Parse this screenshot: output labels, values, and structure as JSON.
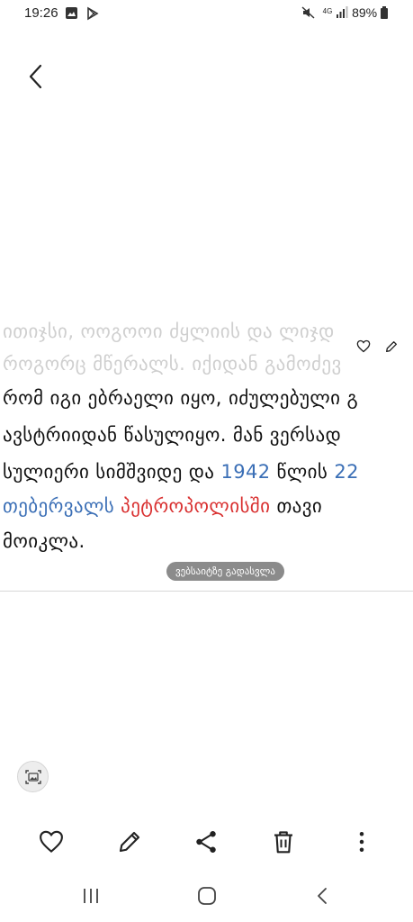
{
  "status_bar": {
    "time": "19:26",
    "network": "4G",
    "battery": "89%"
  },
  "article": {
    "lines": [
      [
        {
          "text": "ითიჯსი, ოოგოოი ძყლიის და ლიჯდ",
          "style": "faded"
        }
      ],
      [
        {
          "text": "როგორც მწერალს. იქიდან გამოძევ",
          "style": "faded"
        }
      ],
      [
        {
          "text": "რომ იგი ებრაელი იყო, იძულებული გ",
          "style": ""
        }
      ],
      [
        {
          "text": "ავსტრიიდან წასულიყო. მან ვერსად",
          "style": ""
        }
      ],
      [
        {
          "text": "სულიერი სიმშვიდე და ",
          "style": ""
        },
        {
          "text": "1942",
          "style": "blue"
        },
        {
          "text": " წლის ",
          "style": ""
        },
        {
          "text": "22",
          "style": "blue"
        }
      ],
      [
        {
          "text": "თებერვალს",
          "style": "blue"
        },
        {
          "text": " ",
          "style": ""
        },
        {
          "text": "პეტროპოლისში",
          "style": "red"
        },
        {
          "text": " თავი",
          "style": ""
        }
      ],
      [
        {
          "text": "მოიკლა.",
          "style": ""
        }
      ]
    ]
  },
  "web_link_label": "ვებსაიტზე გადასვლა",
  "toolbar": {
    "items": [
      {
        "name": "favorite-button",
        "icon": "heart-icon"
      },
      {
        "name": "edit-button",
        "icon": "pencil-icon"
      },
      {
        "name": "share-button",
        "icon": "share-icon"
      },
      {
        "name": "delete-button",
        "icon": "trash-icon"
      },
      {
        "name": "more-button",
        "icon": "more-vertical-icon"
      }
    ]
  },
  "colors": {
    "link_blue": "#3b6fb6",
    "link_red": "#d93030",
    "pill_bg": "#8b8b8b"
  }
}
